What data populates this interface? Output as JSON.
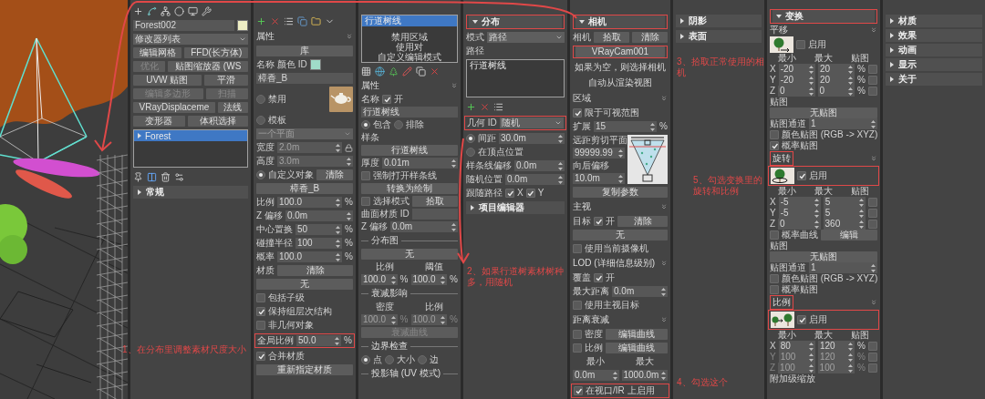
{
  "panels": [
    {
      "rows": [
        {
          "items": [
            {
              "kind": "command-toolbar"
            }
          ]
        },
        {
          "items": [
            {
              "kind": "field",
              "text": "Forest002"
            },
            {
              "kind": "swatch",
              "color": "#eeeec4"
            }
          ]
        },
        {
          "items": [
            {
              "kind": "dropdown",
              "text": "修改器列表"
            }
          ]
        },
        {
          "items": [
            {
              "kind": "button",
              "text": "编辑网格"
            },
            {
              "kind": "button",
              "text": "FFD(长方体)"
            }
          ]
        },
        {
          "items": [
            {
              "kind": "button",
              "text": "优化",
              "disabled": true
            },
            {
              "kind": "button",
              "text": "贴图缩放器 (WS"
            }
          ]
        },
        {
          "items": [
            {
              "kind": "button",
              "text": "UVW 贴图"
            },
            {
              "kind": "button",
              "text": "平滑"
            }
          ]
        },
        {
          "items": [
            {
              "kind": "button",
              "text": "编辑多边形",
              "disabled": true
            },
            {
              "kind": "button",
              "text": "扫描",
              "disabled": true
            }
          ]
        },
        {
          "items": [
            {
              "kind": "button",
              "text": "VRayDisplaceme"
            },
            {
              "kind": "button",
              "text": "法线"
            }
          ]
        },
        {
          "items": [
            {
              "kind": "button",
              "text": "变形器"
            },
            {
              "kind": "button",
              "text": "体积选择"
            }
          ]
        },
        {
          "items": [
            {
              "kind": "listbox",
              "entries": [
                {
                  "text": "Forest",
                  "selected": true,
                  "collapsed": true
                }
              ]
            }
          ]
        },
        {
          "items": [
            {
              "kind": "stack-toolbar"
            }
          ]
        },
        {
          "items": [
            {
              "kind": "rollout",
              "text": "常规",
              "expanded": false
            }
          ]
        }
      ]
    },
    {
      "rows": [
        {
          "items": [
            {
              "kind": "object-toolbar"
            }
          ]
        },
        {
          "items": [
            {
              "kind": "group",
              "text": "属性"
            }
          ]
        },
        {
          "items": [
            {
              "kind": "button",
              "text": "库"
            }
          ]
        },
        {
          "items": [
            {
              "kind": "label",
              "text": "名称"
            },
            {
              "kind": "label",
              "text": "颜色 ID"
            },
            {
              "kind": "swatch",
              "color": "#a0dcc8"
            }
          ]
        },
        {
          "items": [
            {
              "kind": "field",
              "text": "樟香_B"
            }
          ]
        },
        {
          "items": [
            {
              "kind": "radio",
              "text": "禁用",
              "selected": false
            },
            {
              "kind": "teapot"
            }
          ]
        },
        {
          "items": [
            {
              "kind": "radio",
              "text": "模板",
              "selected": false
            }
          ]
        },
        {
          "items": [
            {
              "kind": "dropdown",
              "text": "一个平面",
              "disabled": true
            }
          ]
        },
        {
          "items": [
            {
              "kind": "label",
              "text": "宽度"
            },
            {
              "kind": "spinner",
              "text": "2.0m",
              "disabled": true
            },
            {
              "kind": "lock"
            }
          ]
        },
        {
          "items": [
            {
              "kind": "label",
              "text": "高度"
            },
            {
              "kind": "spinner",
              "text": "3.0m",
              "disabled": true
            }
          ]
        },
        {
          "items": [
            {
              "kind": "radio",
              "text": "自定义对象",
              "selected": true
            },
            {
              "kind": "button",
              "text": "清除"
            }
          ]
        },
        {
          "items": [
            {
              "kind": "button",
              "text": "樟香_B"
            }
          ]
        },
        {
          "items": [
            {
              "kind": "label",
              "text": "比例"
            },
            {
              "kind": "spinner",
              "text": "100.0"
            },
            {
              "kind": "label",
              "text": "%"
            }
          ]
        },
        {
          "items": [
            {
              "kind": "label",
              "text": "Z 偏移"
            },
            {
              "kind": "spinner",
              "text": "0.0m"
            }
          ]
        },
        {
          "items": [
            {
              "kind": "label",
              "text": "中心置换"
            },
            {
              "kind": "spinner",
              "text": "50"
            },
            {
              "kind": "label",
              "text": "%"
            }
          ]
        },
        {
          "items": [
            {
              "kind": "label",
              "text": "碰撞半径"
            },
            {
              "kind": "spinner",
              "text": "100"
            },
            {
              "kind": "label",
              "text": "%"
            }
          ]
        },
        {
          "items": [
            {
              "kind": "label",
              "text": "概率"
            },
            {
              "kind": "spinner",
              "text": "100.0"
            },
            {
              "kind": "label",
              "text": "%"
            }
          ]
        },
        {
          "items": [
            {
              "kind": "label",
              "text": "材质"
            },
            {
              "kind": "button",
              "text": "清除"
            }
          ]
        },
        {
          "items": [
            {
              "kind": "button",
              "text": "无"
            }
          ]
        },
        {
          "items": [
            {
              "kind": "check",
              "text": "包括子级",
              "checked": false
            }
          ]
        },
        {
          "items": [
            {
              "kind": "check",
              "text": "保持组层次结构",
              "checked": true
            }
          ]
        },
        {
          "items": [
            {
              "kind": "check",
              "text": "非几何对象",
              "checked": false
            }
          ]
        },
        {
          "boxed": true,
          "items": [
            {
              "kind": "label",
              "text": "全局比例"
            },
            {
              "kind": "spinner",
              "text": "50.0"
            },
            {
              "kind": "label",
              "text": "%"
            }
          ]
        },
        {
          "items": [
            {
              "kind": "check",
              "text": "合并材质",
              "checked": true
            }
          ]
        },
        {
          "items": [
            {
              "kind": "button",
              "text": "重新指定材质"
            }
          ]
        }
      ]
    },
    {
      "rows": [
        {
          "items": [
            {
              "kind": "listbox",
              "entries": [
                {
                  "text": "行道树线",
                  "selected": true
                }
              ],
              "notes": [
                "禁用区域",
                "使用对",
                "自定义编辑模式"
              ]
            }
          ]
        },
        {
          "items": [
            {
              "kind": "region-toolbar"
            }
          ]
        },
        {
          "items": [
            {
              "kind": "group",
              "text": "属性"
            }
          ]
        },
        {
          "items": [
            {
              "kind": "label",
              "text": "名称"
            },
            {
              "kind": "check",
              "text": "开",
              "checked": true
            }
          ]
        },
        {
          "items": [
            {
              "kind": "field",
              "text": "行道树线"
            }
          ]
        },
        {
          "items": [
            {
              "kind": "radio",
              "text": "包含",
              "selected": true
            },
            {
              "kind": "radio",
              "text": "排除",
              "selected": false
            }
          ]
        },
        {
          "items": [
            {
              "kind": "label",
              "text": "样条"
            }
          ]
        },
        {
          "items": [
            {
              "kind": "button",
              "text": "行道树线"
            }
          ]
        },
        {
          "items": [
            {
              "kind": "label",
              "text": "厚度"
            },
            {
              "kind": "spinner",
              "text": "0.01m"
            }
          ]
        },
        {
          "items": [
            {
              "kind": "check",
              "text": "强制打开样条线",
              "checked": false
            }
          ]
        },
        {
          "items": [
            {
              "kind": "button",
              "text": "转换为绘制"
            }
          ]
        },
        {
          "items": [
            {
              "kind": "check",
              "text": "选择模式",
              "checked": false
            },
            {
              "kind": "button",
              "text": "拾取"
            }
          ]
        },
        {
          "items": [
            {
              "kind": "label",
              "text": "曲面材质 ID"
            },
            {
              "kind": "field"
            }
          ]
        },
        {
          "items": [
            {
              "kind": "label",
              "text": "Z 偏移"
            },
            {
              "kind": "spinner",
              "text": "0.0m"
            }
          ]
        },
        {
          "items": [
            {
              "kind": "divider",
              "text": "分布图"
            }
          ]
        },
        {
          "items": [
            {
              "kind": "button",
              "text": "无"
            }
          ]
        },
        {
          "items": [
            {
              "kind": "label",
              "text": "比例"
            },
            {
              "kind": "label",
              "text": "阈值"
            }
          ]
        },
        {
          "items": [
            {
              "kind": "spinner",
              "text": "100.0"
            },
            {
              "kind": "label",
              "text": "%"
            },
            {
              "kind": "spinner",
              "text": "100.0"
            },
            {
              "kind": "label",
              "text": "%"
            }
          ]
        },
        {
          "items": [
            {
              "kind": "divider",
              "text": "衰减影响"
            }
          ]
        },
        {
          "items": [
            {
              "kind": "label",
              "text": "密度"
            },
            {
              "kind": "label",
              "text": "比例"
            }
          ]
        },
        {
          "items": [
            {
              "kind": "spinner",
              "text": "100.0",
              "disabled": true
            },
            {
              "kind": "label",
              "text": "%",
              "disabled": true
            },
            {
              "kind": "spinner",
              "text": "100.0",
              "disabled": true
            },
            {
              "kind": "label",
              "text": "%",
              "disabled": true
            }
          ]
        },
        {
          "items": [
            {
              "kind": "button",
              "text": "衰减曲线",
              "disabled": true
            }
          ]
        },
        {
          "items": [
            {
              "kind": "divider",
              "text": "边界检查"
            }
          ]
        },
        {
          "items": [
            {
              "kind": "radio",
              "text": "点",
              "selected": true
            },
            {
              "kind": "radio",
              "text": "大小",
              "selected": false
            },
            {
              "kind": "radio",
              "text": "边",
              "selected": false
            }
          ]
        },
        {
          "items": [
            {
              "kind": "divider",
              "text": "投影轴 (UV 模式)"
            }
          ]
        }
      ]
    },
    {
      "rows": [
        {
          "items": [
            {
              "kind": "rollout",
              "text": "分布",
              "expanded": true,
              "boxed": true
            }
          ]
        },
        {
          "items": [
            {
              "kind": "label",
              "text": "模式"
            },
            {
              "kind": "dropdown",
              "text": "路径"
            }
          ]
        },
        {
          "items": [
            {
              "kind": "label",
              "text": "路径"
            }
          ]
        },
        {
          "items": [
            {
              "kind": "listbox",
              "entries": [
                {
                  "text": "行道树线",
                  "selected": false
                }
              ]
            }
          ]
        },
        {
          "items": [
            {
              "kind": "path-toolbar"
            }
          ]
        },
        {
          "boxed": true,
          "items": [
            {
              "kind": "label",
              "text": "几何 ID"
            },
            {
              "kind": "dropdown",
              "text": "随机"
            }
          ]
        },
        {
          "items": [
            {
              "kind": "radio",
              "text": "间距",
              "selected": true
            },
            {
              "kind": "spinner",
              "text": "30.0m"
            }
          ]
        },
        {
          "items": [
            {
              "kind": "radio",
              "text": "在顶点位置",
              "selected": false
            }
          ]
        },
        {
          "items": [
            {
              "kind": "label",
              "text": "样条线偏移"
            },
            {
              "kind": "spinner",
              "text": "0.0m"
            }
          ]
        },
        {
          "items": [
            {
              "kind": "label",
              "text": "随机位置"
            },
            {
              "kind": "spinner",
              "text": "0.0m"
            }
          ]
        },
        {
          "items": [
            {
              "kind": "label",
              "text": "跟随路径"
            },
            {
              "kind": "check",
              "text": "X",
              "checked": true
            },
            {
              "kind": "check",
              "text": "Y",
              "checked": true
            }
          ]
        },
        {
          "items": [
            {
              "kind": "rollout",
              "text": "项目编辑器",
              "expanded": false
            }
          ]
        }
      ]
    },
    {
      "rows": [
        {
          "items": [
            {
              "kind": "rollout",
              "text": "相机",
              "expanded": true,
              "boxed": true
            }
          ]
        },
        {
          "items": [
            {
              "kind": "label",
              "text": "相机"
            },
            {
              "kind": "button",
              "text": "拾取"
            },
            {
              "kind": "button",
              "text": "清除"
            }
          ]
        },
        {
          "items": [
            {
              "kind": "button",
              "text": "VRayCam001",
              "boxed": true
            }
          ]
        },
        {
          "items": [
            {
              "kind": "note",
              "text": "如果为空，则选择相机"
            }
          ]
        },
        {
          "items": [
            {
              "kind": "note",
              "text": "自动从渲染视图"
            }
          ]
        },
        {
          "items": [
            {
              "kind": "group",
              "text": "区域"
            }
          ]
        },
        {
          "items": [
            {
              "kind": "check",
              "text": "限于可视范围",
              "checked": true
            }
          ]
        },
        {
          "items": [
            {
              "kind": "label",
              "text": "扩展"
            },
            {
              "kind": "spinner",
              "text": "15"
            },
            {
              "kind": "label",
              "text": "%"
            }
          ]
        },
        {
          "items": [
            {
              "kind": "stack",
              "rows": [
                [
                  {
                    "kind": "label",
                    "text": "远距剪切平面"
                  }
                ],
                [
                  {
                    "kind": "spinner",
                    "text": "99999.99"
                  }
                ],
                [
                  {
                    "kind": "label",
                    "text": "向后偏移"
                  }
                ],
                [
                  {
                    "kind": "spinner",
                    "text": "10.0m"
                  }
                ]
              ]
            },
            {
              "kind": "frustum"
            }
          ]
        },
        {
          "items": [
            {
              "kind": "button",
              "text": "复制参数"
            }
          ]
        },
        {
          "items": [
            {
              "kind": "group",
              "text": "主视"
            }
          ]
        },
        {
          "items": [
            {
              "kind": "label",
              "text": "目标"
            },
            {
              "kind": "check",
              "text": "开",
              "checked": true
            },
            {
              "kind": "button",
              "text": "清除"
            }
          ]
        },
        {
          "items": [
            {
              "kind": "button",
              "text": "无"
            }
          ]
        },
        {
          "items": [
            {
              "kind": "check",
              "text": "使用当前摄像机",
              "checked": false
            }
          ]
        },
        {
          "items": [
            {
              "kind": "group",
              "text": "LOD (详细信息级别)"
            }
          ]
        },
        {
          "items": [
            {
              "kind": "label",
              "text": "覆盖"
            },
            {
              "kind": "check",
              "text": "开",
              "checked": true
            }
          ]
        },
        {
          "items": [
            {
              "kind": "label",
              "text": "最大距离"
            },
            {
              "kind": "spinner",
              "text": "0.0m"
            }
          ]
        },
        {
          "items": [
            {
              "kind": "check",
              "text": "使用主视目标",
              "checked": false
            }
          ]
        },
        {
          "items": [
            {
              "kind": "group",
              "text": "距离衰减"
            }
          ]
        },
        {
          "items": [
            {
              "kind": "check",
              "text": "密度",
              "checked": false
            },
            {
              "kind": "button",
              "text": "编辑曲线"
            }
          ]
        },
        {
          "items": [
            {
              "kind": "check",
              "text": "比例",
              "checked": false
            },
            {
              "kind": "button",
              "text": "编辑曲线"
            }
          ]
        },
        {
          "items": [
            {
              "kind": "label",
              "text": "最小"
            },
            {
              "kind": "label",
              "text": "最大"
            }
          ]
        },
        {
          "items": [
            {
              "kind": "spinner",
              "text": "0.0m"
            },
            {
              "kind": "spinner",
              "text": "1000.0m"
            }
          ]
        },
        {
          "boxed": true,
          "items": [
            {
              "kind": "check",
              "text": "在视口/IR 上启用",
              "checked": true
            }
          ]
        }
      ]
    },
    {
      "rows": [
        {
          "items": [
            {
              "kind": "rollout",
              "text": "阴影",
              "expanded": false
            }
          ]
        },
        {
          "items": [
            {
              "kind": "rollout",
              "text": "表面",
              "expanded": false
            }
          ]
        }
      ]
    },
    {
      "rows": [
        {
          "items": [
            {
              "kind": "rollout",
              "text": "变换",
              "expanded": true,
              "boxed": true
            }
          ]
        },
        {
          "items": [
            {
              "kind": "group",
              "text": "平移"
            }
          ]
        },
        {
          "items": [
            {
              "kind": "tree-move"
            },
            {
              "kind": "check",
              "text": "启用",
              "checked": false
            }
          ]
        },
        {
          "items": [
            {
              "kind": "label",
              "text": "最小"
            },
            {
              "kind": "label",
              "text": "最大"
            },
            {
              "kind": "label",
              "text": "贴图"
            }
          ]
        },
        {
          "items": [
            {
              "kind": "label",
              "text": "X"
            },
            {
              "kind": "spinner",
              "text": "-20"
            },
            {
              "kind": "spinner",
              "text": "20"
            },
            {
              "kind": "label",
              "text": "%"
            },
            {
              "kind": "check",
              "checked": false
            }
          ]
        },
        {
          "items": [
            {
              "kind": "label",
              "text": "Y"
            },
            {
              "kind": "spinner",
              "text": "-20"
            },
            {
              "kind": "spinner",
              "text": "20"
            },
            {
              "kind": "label",
              "text": "%"
            },
            {
              "kind": "check",
              "checked": false
            }
          ]
        },
        {
          "items": [
            {
              "kind": "label",
              "text": "Z"
            },
            {
              "kind": "spinner",
              "text": "0"
            },
            {
              "kind": "spinner",
              "text": "0"
            },
            {
              "kind": "label",
              "text": "%"
            },
            {
              "kind": "check",
              "checked": false
            }
          ]
        },
        {
          "items": [
            {
              "kind": "label",
              "text": "贴图"
            }
          ]
        },
        {
          "items": [
            {
              "kind": "button",
              "text": "无贴图"
            }
          ]
        },
        {
          "items": [
            {
              "kind": "label",
              "text": "贴图通道"
            },
            {
              "kind": "spinner",
              "text": "1"
            }
          ]
        },
        {
          "items": [
            {
              "kind": "check",
              "text": "颜色贴图 (RGB -> XYZ)",
              "checked": false
            }
          ]
        },
        {
          "items": [
            {
              "kind": "check",
              "text": "概率贴图",
              "checked": true
            }
          ]
        },
        {
          "items": [
            {
              "kind": "group",
              "text": "旋转",
              "boxed": true
            }
          ]
        },
        {
          "boxed": true,
          "items": [
            {
              "kind": "tree-rotate"
            },
            {
              "kind": "check",
              "text": "启用",
              "checked": true
            }
          ]
        },
        {
          "items": [
            {
              "kind": "label",
              "text": "最小"
            },
            {
              "kind": "label",
              "text": "最大"
            },
            {
              "kind": "label",
              "text": "贴图"
            }
          ]
        },
        {
          "items": [
            {
              "kind": "label",
              "text": "X"
            },
            {
              "kind": "spinner",
              "text": "-5"
            },
            {
              "kind": "spinner",
              "text": "5"
            },
            {
              "kind": "check",
              "checked": false
            }
          ]
        },
        {
          "items": [
            {
              "kind": "label",
              "text": "Y"
            },
            {
              "kind": "spinner",
              "text": "-5"
            },
            {
              "kind": "spinner",
              "text": "5"
            },
            {
              "kind": "check",
              "checked": false
            }
          ]
        },
        {
          "items": [
            {
              "kind": "label",
              "text": "Z"
            },
            {
              "kind": "spinner",
              "text": "0"
            },
            {
              "kind": "spinner",
              "text": "360"
            },
            {
              "kind": "check",
              "checked": false
            }
          ]
        },
        {
          "items": [
            {
              "kind": "check",
              "text": "概率曲线",
              "checked": false
            },
            {
              "kind": "button",
              "text": "编辑"
            }
          ]
        },
        {
          "items": [
            {
              "kind": "label",
              "text": "贴图"
            }
          ]
        },
        {
          "items": [
            {
              "kind": "button",
              "text": "无贴图"
            }
          ]
        },
        {
          "items": [
            {
              "kind": "label",
              "text": "贴图通道"
            },
            {
              "kind": "spinner",
              "text": "1"
            }
          ]
        },
        {
          "items": [
            {
              "kind": "check",
              "text": "颜色贴图 (RGB -> XYZ)",
              "checked": false
            }
          ]
        },
        {
          "items": [
            {
              "kind": "check",
              "text": "概率贴图",
              "checked": false
            }
          ]
        },
        {
          "items": [
            {
              "kind": "group",
              "text": "比例",
              "boxed": true
            }
          ]
        },
        {
          "boxed": true,
          "items": [
            {
              "kind": "tree-scale"
            },
            {
              "kind": "check",
              "text": "启用",
              "checked": true
            }
          ]
        },
        {
          "items": [
            {
              "kind": "label",
              "text": "最小"
            },
            {
              "kind": "label",
              "text": "最大"
            },
            {
              "kind": "label",
              "text": "贴图"
            }
          ]
        },
        {
          "items": [
            {
              "kind": "label",
              "text": "X"
            },
            {
              "kind": "spinner",
              "text": "80"
            },
            {
              "kind": "spinner",
              "text": "120"
            },
            {
              "kind": "label",
              "text": "%"
            },
            {
              "kind": "check",
              "checked": false
            }
          ]
        },
        {
          "items": [
            {
              "kind": "label",
              "text": "Y",
              "disabled": true
            },
            {
              "kind": "spinner",
              "text": "100",
              "disabled": true
            },
            {
              "kind": "spinner",
              "text": "120",
              "disabled": true
            },
            {
              "kind": "label",
              "text": "%",
              "disabled": true
            },
            {
              "kind": "check",
              "checked": false
            }
          ]
        },
        {
          "items": [
            {
              "kind": "label",
              "text": "Z",
              "disabled": true
            },
            {
              "kind": "spinner",
              "text": "100",
              "disabled": true
            },
            {
              "kind": "spinner",
              "text": "100",
              "disabled": true
            },
            {
              "kind": "label",
              "text": "%",
              "disabled": true
            },
            {
              "kind": "check",
              "checked": false
            }
          ]
        },
        {
          "items": [
            {
              "kind": "label",
              "text": "附加级缩放"
            }
          ]
        }
      ]
    },
    {
      "rows": [
        {
          "items": [
            {
              "kind": "rollout",
              "text": "材质",
              "expanded": false
            }
          ]
        },
        {
          "items": [
            {
              "kind": "rollout",
              "text": "效果",
              "expanded": false
            }
          ]
        },
        {
          "items": [
            {
              "kind": "rollout",
              "text": "动画",
              "expanded": false
            }
          ]
        },
        {
          "items": [
            {
              "kind": "rollout",
              "text": "显示",
              "expanded": false
            }
          ]
        },
        {
          "items": [
            {
              "kind": "rollout",
              "text": "关于",
              "expanded": false
            }
          ]
        }
      ]
    }
  ],
  "annotations": [
    {
      "text": "1、在分布里调整素材尺度大小"
    },
    {
      "text": "2、如果行道树素材树种多，用随机"
    },
    {
      "text": "3、拾取正常使用的相机"
    },
    {
      "text": "5、勾选变换里的旋转和比例"
    },
    {
      "text": "4、勾选这个"
    }
  ]
}
